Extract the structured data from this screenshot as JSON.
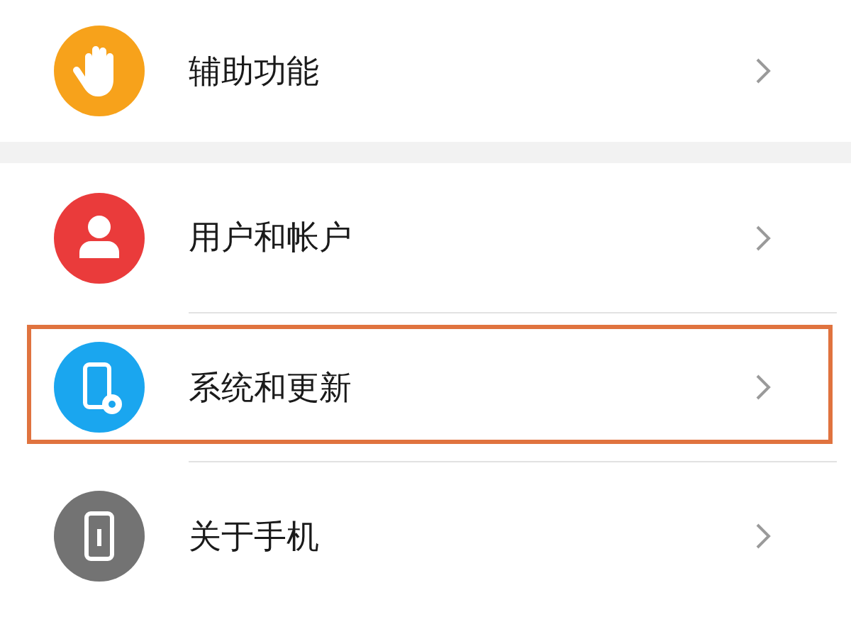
{
  "groups": [
    {
      "items": [
        {
          "label": "辅助功能",
          "kind": "hand",
          "highlighted": false
        }
      ]
    },
    {
      "items": [
        {
          "label": "用户和帐户",
          "kind": "user",
          "highlighted": false
        },
        {
          "label": "系统和更新",
          "kind": "system",
          "highlighted": true
        },
        {
          "label": "关于手机",
          "kind": "phone",
          "highlighted": false
        }
      ]
    }
  ]
}
